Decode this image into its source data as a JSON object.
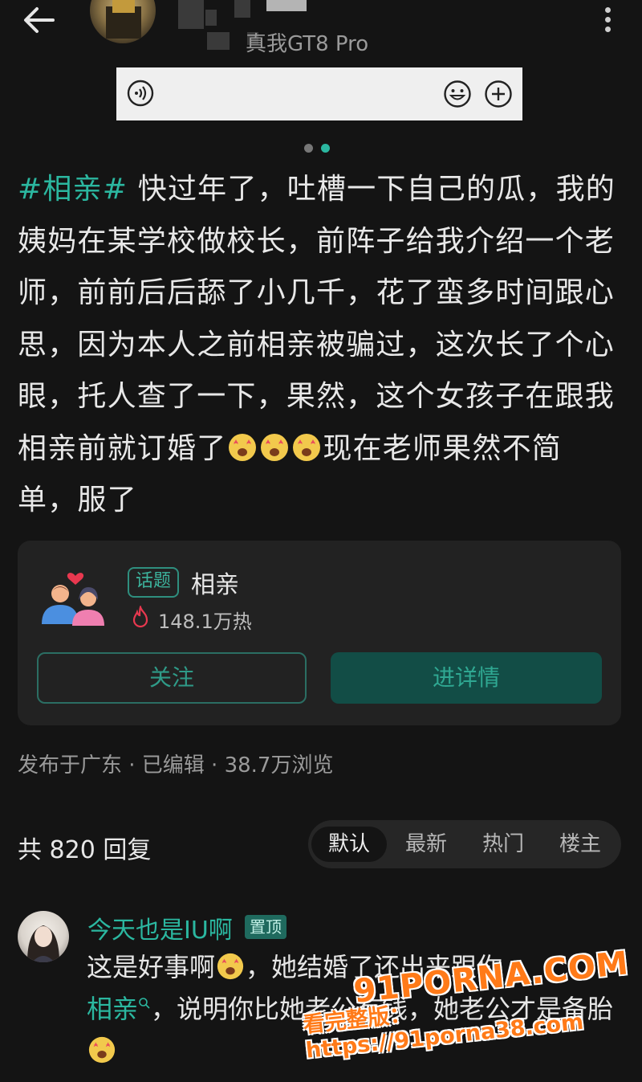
{
  "header": {
    "device_label": "真我GT8 Pro"
  },
  "post": {
    "hashtag": "#相亲#",
    "text_part1": " 快过年了，吐槽一下自己的瓜，我的姨妈在某学校做校长，前阵子给我介绍一个老师，前前后后舔了小几千，花了蛮多时间跟心思，因为本人之前相亲被骗过，这次长了个心眼，托人查了一下，果然，这个女孩子在跟我相亲前就订婚了",
    "text_part2": "现在老师果然不简单，服了"
  },
  "topic": {
    "tag": "话题",
    "name": "相亲",
    "heat": "148.1万热",
    "follow_label": "关注",
    "detail_label": "进详情"
  },
  "meta": "发布于广东 · 已编辑 · 38.7万浏览",
  "replies": {
    "count_label": "共 820 回复",
    "sort_tabs": [
      "默认",
      "最新",
      "热门",
      "楼主"
    ]
  },
  "comment": {
    "user": "今天也是IU啊",
    "badge": "置顶",
    "text_part1": "这是好事啊",
    "text_part2": "，她结婚了还出来跟你",
    "link": "相亲",
    "text_part3": "，说明你比她老公有钱，她老公才是备胎"
  },
  "watermark": {
    "logo": "91PORNA.COM",
    "sub": "看完整版：https://91porna38.com"
  },
  "colors": {
    "background": "#141414",
    "accent": "#2bb7a0",
    "card": "#222222",
    "watermark": "#ff7a18"
  }
}
